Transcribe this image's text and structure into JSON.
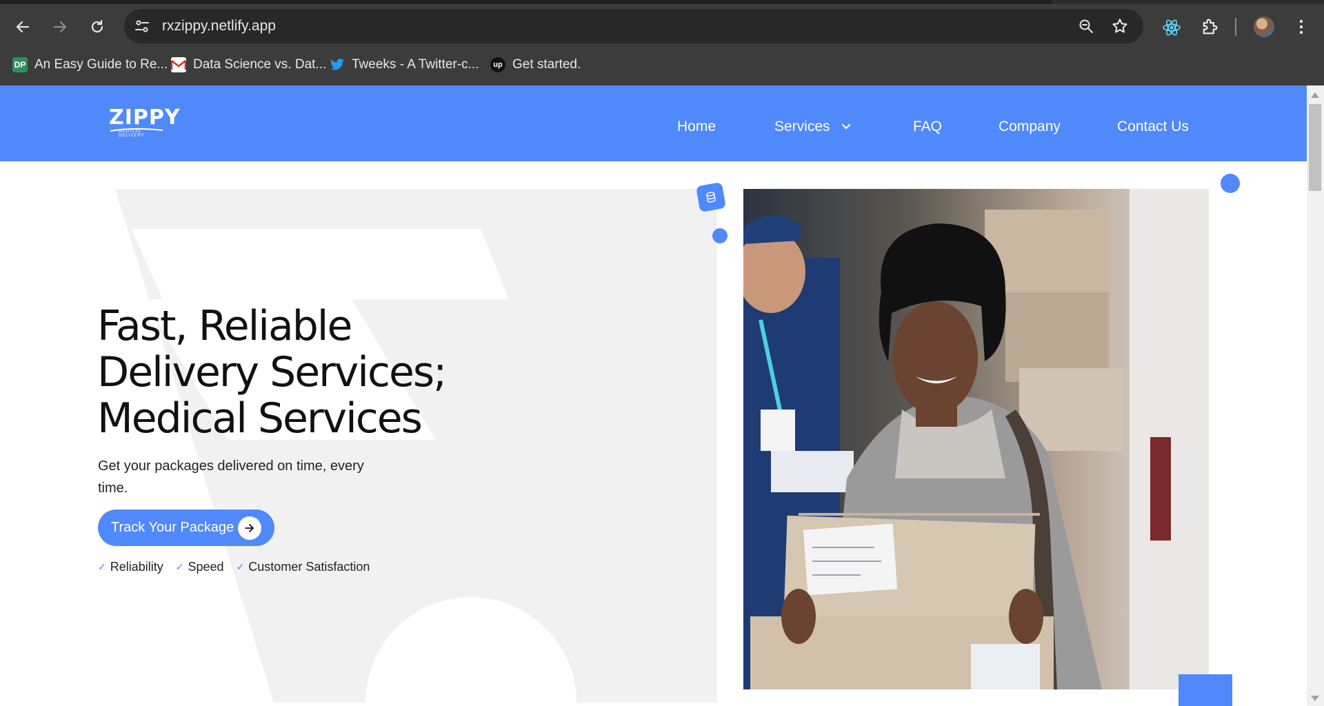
{
  "browser": {
    "url": "rxzippy.netlify.app",
    "bookmarks": [
      {
        "icon": "dp-favicon",
        "label": "An Easy Guide to Re..."
      },
      {
        "icon": "gmail-favicon",
        "label": "Data Science vs. Dat..."
      },
      {
        "icon": "twitter-favicon",
        "label": "Tweeks - A Twitter-c..."
      },
      {
        "icon": "upwork-favicon",
        "label": "Get started."
      }
    ],
    "bookmark_dp_text": "DP",
    "bookmark_up_text": "up"
  },
  "site": {
    "logo_text": "ZIPPY",
    "logo_tagline": "MEDICAL DELIVERY",
    "nav": {
      "home": "Home",
      "services": "Services",
      "faq": "FAQ",
      "company": "Company",
      "contact": "Contact Us"
    }
  },
  "hero": {
    "title_line1": "Fast, Reliable",
    "title_line2": "Delivery Services;",
    "title_line3": "Medical Services",
    "subtitle": "Get your packages delivered on time, every time.",
    "cta_label": "Track Your Package",
    "features": [
      "Reliability",
      "Speed",
      "Customer Satisfaction"
    ]
  },
  "colors": {
    "brand_blue": "#5089fb",
    "chrome_dark": "#3c3c3c",
    "hero_shape_gray": "#f1f1f1"
  }
}
